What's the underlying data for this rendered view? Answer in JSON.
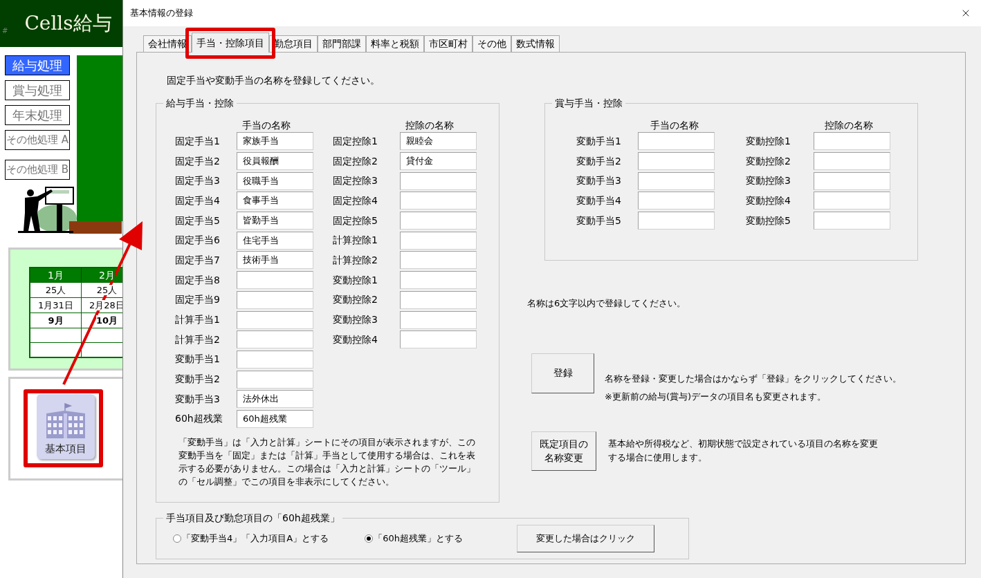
{
  "sheet": {
    "title_mark": "#",
    "title": "Cells給与",
    "menu": [
      {
        "label": "給与処理",
        "selected": true
      },
      {
        "label": "賞与処理",
        "selected": false
      },
      {
        "label": "年末処理",
        "selected": false
      },
      {
        "label": "その他処理 A",
        "selected": false
      },
      {
        "label": "その他処理 B",
        "selected": false
      }
    ],
    "calendar": {
      "columns": [
        "1月",
        "2月"
      ],
      "rows": [
        {
          "cells": [
            "25人",
            "25人"
          ],
          "bold": false
        },
        {
          "cells": [
            "1月31日",
            "2月28日"
          ],
          "bold": false
        },
        {
          "cells": [
            "9月",
            "10月"
          ],
          "bold": true
        }
      ]
    },
    "shortcut": {
      "label": "基本項目"
    }
  },
  "dialog": {
    "title": "基本情報の登録",
    "tabs": [
      {
        "label": "会社情報",
        "selected": false
      },
      {
        "label": "手当・控除項目",
        "selected": true
      },
      {
        "label": "勤怠項目",
        "selected": false
      },
      {
        "label": "部門部課",
        "selected": false
      },
      {
        "label": "料率と税額",
        "selected": false
      },
      {
        "label": "市区町村",
        "selected": false
      },
      {
        "label": "その他",
        "selected": false
      },
      {
        "label": "数式情報",
        "selected": false
      }
    ],
    "intro": "固定手当や変動手当の名称を登録してください。",
    "salary_group": {
      "title": "給与手当・控除",
      "allowance_header": "手当の名称",
      "deduction_header": "控除の名称",
      "allowances": [
        {
          "label": "固定手当1",
          "value": "家族手当"
        },
        {
          "label": "固定手当2",
          "value": "役員報酬"
        },
        {
          "label": "固定手当3",
          "value": "役職手当"
        },
        {
          "label": "固定手当4",
          "value": "食事手当"
        },
        {
          "label": "固定手当5",
          "value": "皆勤手当"
        },
        {
          "label": "固定手当6",
          "value": "住宅手当"
        },
        {
          "label": "固定手当7",
          "value": "技術手当"
        },
        {
          "label": "固定手当8"
        },
        {
          "label": "固定手当9"
        },
        {
          "label": "計算手当1"
        },
        {
          "label": "計算手当2"
        },
        {
          "label": "変動手当1"
        },
        {
          "label": "変動手当2"
        },
        {
          "label": "変動手当3",
          "value": "法外休出"
        },
        {
          "label": "60h超残業",
          "value": "60h超残業"
        }
      ],
      "deductions": [
        {
          "label": "固定控除1",
          "value": "親睦会"
        },
        {
          "label": "固定控除2",
          "value": "貸付金"
        },
        {
          "label": "固定控除3"
        },
        {
          "label": "固定控除4"
        },
        {
          "label": "固定控除5"
        },
        {
          "label": "計算控除1"
        },
        {
          "label": "計算控除2"
        },
        {
          "label": "変動控除1"
        },
        {
          "label": "変動控除2"
        },
        {
          "label": "変動控除3"
        },
        {
          "label": "変動控除4"
        }
      ],
      "note": "「変動手当」は「入力と計算」シートにその項目が表示されますが、この変動手当を「固定」または「計算」手当として使用する場合は、これを表示する必要がありません。この場合は「入力と計算」シートの「ツール」の「セル調整」でこの項目を非表示にしてください。"
    },
    "bonus_group": {
      "title": "賞与手当・控除",
      "allowance_header": "手当の名称",
      "deduction_header": "控除の名称",
      "allowances": [
        {
          "label": "変動手当1"
        },
        {
          "label": "変動手当2"
        },
        {
          "label": "変動手当3"
        },
        {
          "label": "変動手当4"
        },
        {
          "label": "変動手当5"
        }
      ],
      "deductions": [
        {
          "label": "変動控除1"
        },
        {
          "label": "変動控除2"
        },
        {
          "label": "変動控除3"
        },
        {
          "label": "変動控除4"
        },
        {
          "label": "変動控除5"
        }
      ]
    },
    "name_limit_note": "名称は6文字以内で登録してください。",
    "register_button": "登録",
    "register_notes": [
      "名称を登録・変更した場合はかならず「登録」をクリックしてください。",
      "※更新前の給与(賞与)データの項目名も変更されます。"
    ],
    "rename_button": [
      "既定項目の",
      "名称変更"
    ],
    "rename_note": "基本給や所得税など、初期状態で設定されている項目の名称を変更する場合に使用します。",
    "overtime_group": {
      "title": "手当項目及び勤怠項目の「60h超残業」",
      "options": [
        {
          "label": "「変動手当4」「入力項目A」とする",
          "selected": false
        },
        {
          "label": "「60h超残業」とする",
          "selected": true
        }
      ],
      "button": "変更した場合はクリック"
    }
  }
}
